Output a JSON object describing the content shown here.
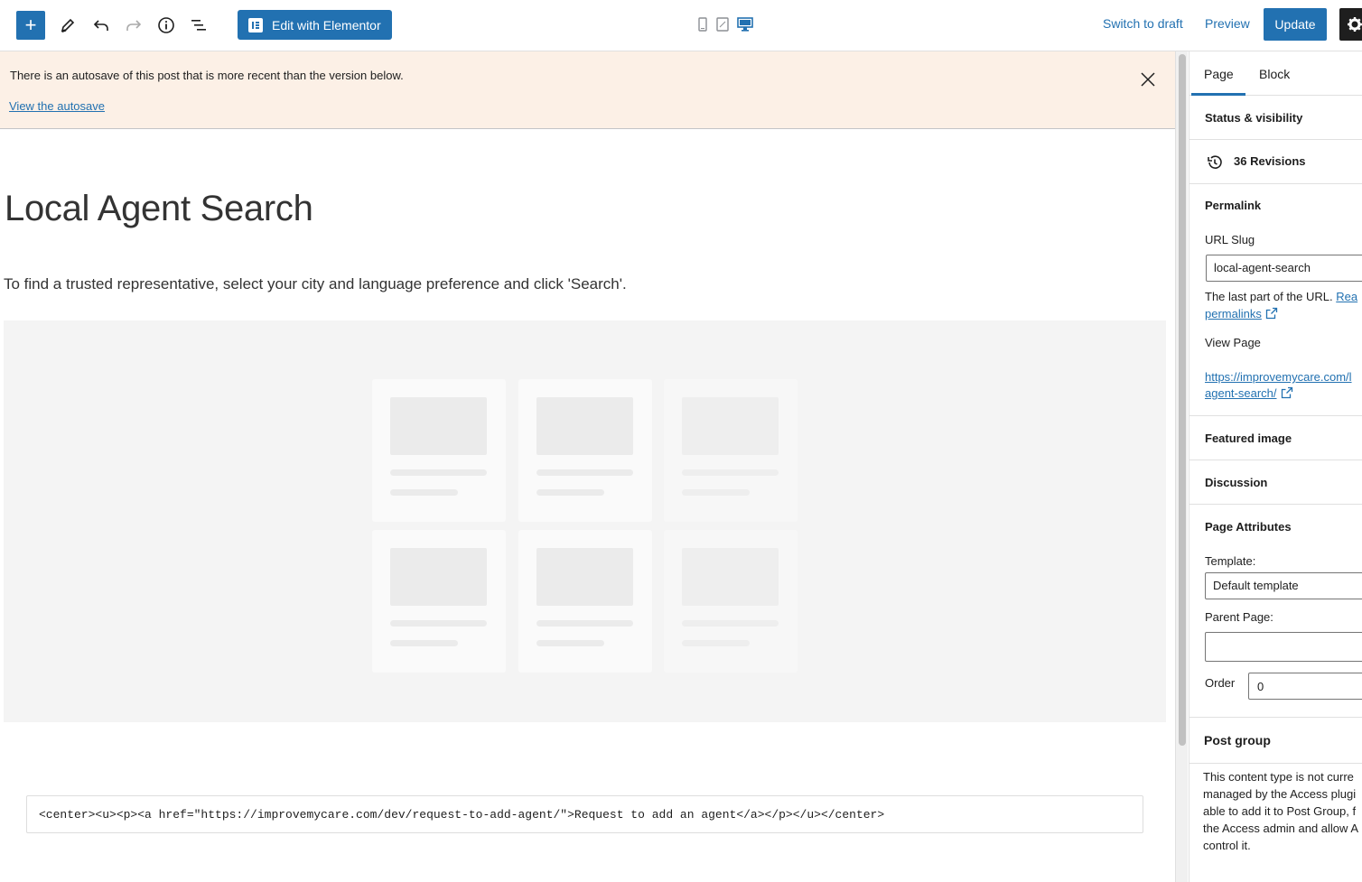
{
  "toolbar": {
    "add_label": "+",
    "edit_elementor_label": "Edit with Elementor",
    "switch_draft_label": "Switch to draft",
    "preview_label": "Preview",
    "update_label": "Update",
    "icons": [
      "pencil-icon",
      "undo-icon",
      "redo-icon",
      "info-icon",
      "list-view-icon",
      "mobile-icon",
      "tablet-icon",
      "desktop-icon",
      "gear-icon"
    ]
  },
  "notice": {
    "text": "There is an autosave of this post that is more recent than the version below.",
    "link": "View the autosave"
  },
  "content": {
    "title": "Local Agent Search",
    "intro": "To find a trusted representative, select your city and language preference and click 'Search'.",
    "code": "<center><u><p><a href=\"https://improvemycare.com/dev/request-to-add-agent/\">Request to add an agent</a></p></u></center>"
  },
  "sidebar": {
    "tabs": [
      "Page",
      "Block"
    ],
    "status_visibility": "Status & visibility",
    "revisions": "36 Revisions",
    "permalink": {
      "title": "Permalink",
      "url_slug_label": "URL Slug",
      "url_slug_value": "local-agent-search",
      "help_text": "The last part of the URL.",
      "help_link_1": "Rea",
      "help_link_2": "permalinks",
      "view_page_label": "View Page",
      "view_link_1": "https://improvemycare.com/l",
      "view_link_2": "agent-search/"
    },
    "featured_image": "Featured image",
    "discussion": "Discussion",
    "page_attributes": {
      "title": "Page Attributes",
      "template_label": "Template:",
      "template_value": "Default template",
      "parent_label": "Parent Page:",
      "parent_value": "",
      "order_label": "Order",
      "order_value": "0"
    },
    "post_group": {
      "title": "Post group",
      "lines": [
        "This content type is not curre",
        "managed by the Access plugi",
        "able to add it to Post Group, f",
        "the Access admin and allow A",
        "control it."
      ]
    }
  }
}
